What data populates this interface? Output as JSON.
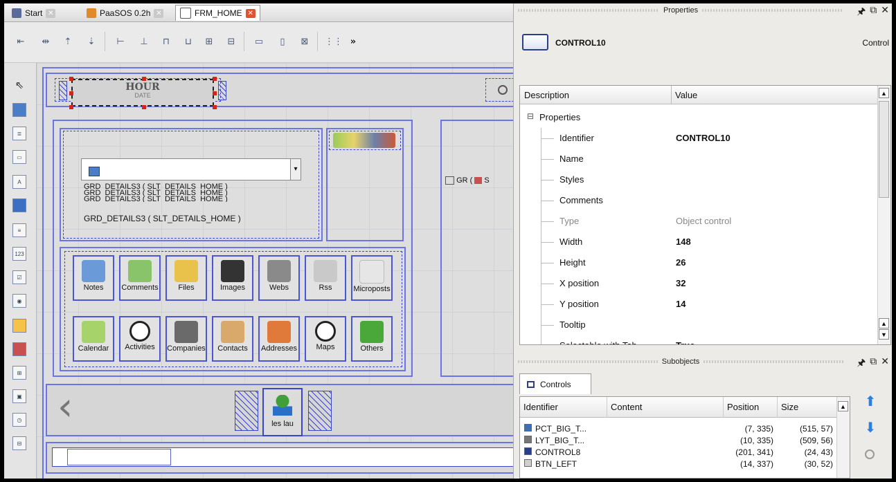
{
  "tabs": [
    {
      "label": "Start",
      "active": false
    },
    {
      "label": "PaaSOS 0.2h",
      "active": false
    },
    {
      "label": "FRM_HOME",
      "active": true
    }
  ],
  "toolbar": {
    "overflow_label": "»"
  },
  "canvas": {
    "hour_label": "HOUR",
    "date_label": "DATE",
    "grid_rows": [
      "GRD_DETAILS3 ( SLT_DETAILS_HOME )",
      "GRD_DETAILS3 ( SLT_DETAILS_HOME )",
      "GRD_DETAILS3 ( SLT_DETAILS_HOME )",
      "GRD_DETAILS3 ( SLT_DETAILS_HOME )"
    ],
    "gr_label": "GR (",
    "gr_suffix": "S",
    "buttons_row1": [
      "Notes",
      "Comments",
      "Files",
      "Images",
      "Webs",
      "Rss",
      "Microposts"
    ],
    "buttons_row2": [
      "Calendar",
      "Activities",
      "Companies",
      "Contacts",
      "Addresses",
      "Maps",
      "Others"
    ],
    "bottom_button_label": "les lau",
    "left_arrow": "‹"
  },
  "properties": {
    "pane_title": "Properties",
    "control_name": "CONTROL10",
    "control_type": "Control",
    "col_description": "Description",
    "col_value": "Value",
    "group_label": "Properties",
    "group_toggle": "⊟",
    "rows": [
      {
        "key": "Identifier",
        "value": "CONTROL10",
        "disabled": false
      },
      {
        "key": "Name",
        "value": "",
        "disabled": false
      },
      {
        "key": "Styles",
        "value": "",
        "disabled": false
      },
      {
        "key": "Comments",
        "value": "",
        "disabled": false
      },
      {
        "key": "Type",
        "value": "Object control",
        "disabled": true
      },
      {
        "key": "Width",
        "value": "148",
        "disabled": false
      },
      {
        "key": "Height",
        "value": "26",
        "disabled": false
      },
      {
        "key": "X position",
        "value": "32",
        "disabled": false
      },
      {
        "key": "Y position",
        "value": "14",
        "disabled": false
      },
      {
        "key": "Tooltip",
        "value": "",
        "disabled": false
      },
      {
        "key": "Selectable with Tab",
        "value": "True",
        "disabled": false
      }
    ]
  },
  "subobjects": {
    "pane_title": "Subobjects",
    "tab_label": "Controls",
    "columns": [
      "Identifier",
      "Content",
      "Position",
      "Size"
    ],
    "rows": [
      {
        "id": "PCT_BIG_T...",
        "content": "",
        "position": "(7, 335)",
        "size": "(515, 57)",
        "color": "#3c6fb4"
      },
      {
        "id": "LYT_BIG_T...",
        "content": "",
        "position": "(10, 335)",
        "size": "(509, 56)",
        "color": "#777777"
      },
      {
        "id": "CONTROL8",
        "content": "",
        "position": "(201, 341)",
        "size": "(24, 43)",
        "color": "#2a3f8a"
      },
      {
        "id": "BTN_LEFT",
        "content": "",
        "position": "(14, 337)",
        "size": "(30, 52)",
        "color": "#cfcfcf"
      }
    ]
  },
  "pane_icons": {
    "pin": "🖈",
    "float": "⧉",
    "close": "✕"
  }
}
